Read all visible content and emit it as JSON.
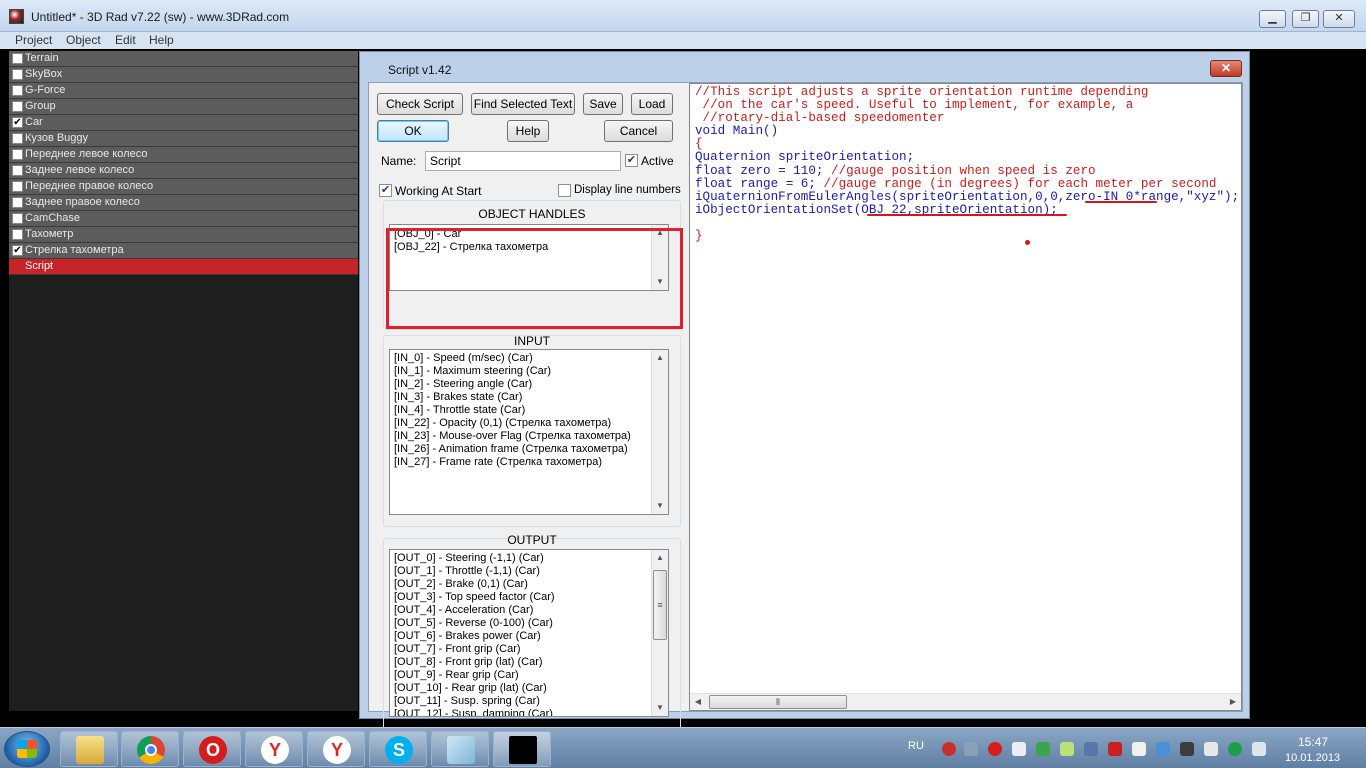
{
  "window": {
    "title": "Untitled* - 3D Rad v7.22 (sw) - www.3DRad.com",
    "min_symbol": "▁",
    "max_symbol": "❐",
    "close_symbol": "✕"
  },
  "menu": [
    "Project",
    "Object",
    "Edit",
    "Help"
  ],
  "objects": [
    {
      "label": "Terrain",
      "checked": false
    },
    {
      "label": "SkyBox",
      "checked": false
    },
    {
      "label": "G-Force",
      "checked": false
    },
    {
      "label": "Group",
      "checked": false
    },
    {
      "label": "Car",
      "checked": true
    },
    {
      "label": "Кузов Buggy",
      "checked": false
    },
    {
      "label": "Переднее левое колесо",
      "checked": false
    },
    {
      "label": "Заднее левое колесо",
      "checked": false
    },
    {
      "label": "Переднее правое колесо",
      "checked": false
    },
    {
      "label": "Заднее правое колесо",
      "checked": false
    },
    {
      "label": "CamChase",
      "checked": false
    },
    {
      "label": "Тахометр",
      "checked": false
    },
    {
      "label": "Стрелка тахометра",
      "checked": true
    },
    {
      "label": "Script",
      "checked": null,
      "selected": true
    }
  ],
  "dialog": {
    "title": "Script v1.42",
    "close_symbol": "✕",
    "buttons": {
      "check_script": "Check Script",
      "find_selected": "Find Selected Text",
      "save": "Save",
      "load": "Load",
      "ok": "OK",
      "help": "Help",
      "cancel": "Cancel"
    },
    "name_label": "Name:",
    "name_value": "Script",
    "active_label": "Active",
    "active_checked": true,
    "working_at_start_label": "Working At Start",
    "working_at_start_checked": true,
    "display_line_numbers_label": "Display line numbers",
    "display_line_numbers_checked": false,
    "object_handles_title": "OBJECT HANDLES",
    "object_handles": [
      "[OBJ_0] - Car",
      "[OBJ_22] - Стрелка тахометра"
    ],
    "input_title": "INPUT",
    "inputs": [
      "[IN_0] - Speed (m/sec) (Car)",
      "[IN_1] - Maximum steering (Car)",
      "[IN_2] - Steering angle (Car)",
      "[IN_3] - Brakes state (Car)",
      "[IN_4] - Throttle state (Car)",
      "[IN_22] - Opacity (0,1) (Стрелка тахометра)",
      "[IN_23] - Mouse-over Flag (Стрелка тахометра)",
      "[IN_26] - Animation frame (Стрелка тахометра)",
      "[IN_27] - Frame rate (Стрелка тахометра)"
    ],
    "output_title": "OUTPUT",
    "outputs": [
      "[OUT_0] - Steering (-1,1) (Car)",
      "[OUT_1] - Throttle (-1,1) (Car)",
      "[OUT_2] - Brake (0,1) (Car)",
      "[OUT_3] - Top speed factor (Car)",
      "[OUT_4] - Acceleration (Car)",
      "[OUT_5] - Reverse (0-100) (Car)",
      "[OUT_6] - Brakes power (Car)",
      "[OUT_7] - Front grip (Car)",
      "[OUT_8] - Front grip (lat) (Car)",
      "[OUT_9] - Rear grip (Car)",
      "[OUT_10] - Rear grip (lat) (Car)",
      "[OUT_11] - Susp. spring (Car)",
      "[OUT_12] - Susp. damping (Car)"
    ],
    "code": [
      {
        "text": "//This script adjusts a sprite orientation runtime depending",
        "color": "red"
      },
      {
        "text": " //on the car's speed. Useful to implement, for example, a",
        "color": "red"
      },
      {
        "text": " //rotary-dial-based speedomenter",
        "color": "red"
      },
      {
        "text": "void Main()",
        "color": "blue"
      },
      {
        "text": "{",
        "color": "red"
      },
      {
        "text": "Quaternion spriteOrientation;",
        "color": "blue"
      },
      {
        "text": "float zero = 110; ",
        "color": "blue",
        "comment": "//gauge position when speed is zero"
      },
      {
        "text": "float range = 6; ",
        "color": "blue",
        "comment": "//gauge range (in degrees) for each meter per second"
      },
      {
        "text": "iQuaternionFromEulerAngles(spriteOrientation,0,0,zero-IN_0*range,\"xyz\");",
        "color": "blue"
      },
      {
        "text": "iObjectOrientationSet(OBJ_22,spriteOrientation);",
        "color": "blue"
      },
      {
        "text": "",
        "color": "blue"
      },
      {
        "text": "}",
        "color": "red"
      }
    ]
  },
  "taskbar": {
    "apps": [
      "file-explorer",
      "chrome",
      "opera",
      "yandex-browser",
      "yandex",
      "skype",
      "notepad",
      "3d-rad"
    ],
    "lang": "RU",
    "time": "15:47",
    "date": "10.01.2013"
  }
}
